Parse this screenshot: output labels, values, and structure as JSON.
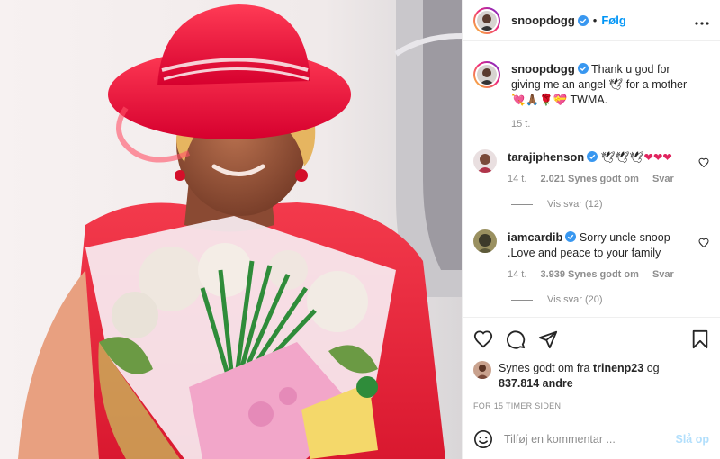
{
  "post": {
    "author": "snoopdogg",
    "follow_label": "Følg",
    "separator": "•",
    "more_icon": "more-horizontal-icon",
    "caption": {
      "username": "snoopdogg",
      "text": "Thank u god for giving me an angel 🕊 for a mother 💘🙏🏾🌹💝 TWMA.",
      "time": "15 t."
    }
  },
  "comments": [
    {
      "username": "tarajiphenson",
      "text": "🕊🕊🕊",
      "hearts": "❤❤❤",
      "time": "14 t.",
      "likes": "2.021 Synes godt om",
      "reply_label": "Svar",
      "view_replies": "Vis svar (12)"
    },
    {
      "username": "iamcardib",
      "text": "Sorry uncle snoop .Love and peace to your family",
      "time": "14 t.",
      "likes": "3.939 Synes godt om",
      "reply_label": "Svar",
      "view_replies": "Vis svar (20)"
    }
  ],
  "likes": {
    "prefix": "Synes godt om fra",
    "liker": "trinenp23",
    "joiner": "og",
    "others": "837.814 andre"
  },
  "timestamp": "For 15 timer siden",
  "add_comment": {
    "placeholder": "Tilføj en kommentar ...",
    "post_label": "Slå op"
  },
  "colors": {
    "accent": "#0095f6",
    "verified": "#3897f0",
    "heart": "#e0245e",
    "muted": "#8e8e8e",
    "post_disabled": "#b2dffc"
  }
}
